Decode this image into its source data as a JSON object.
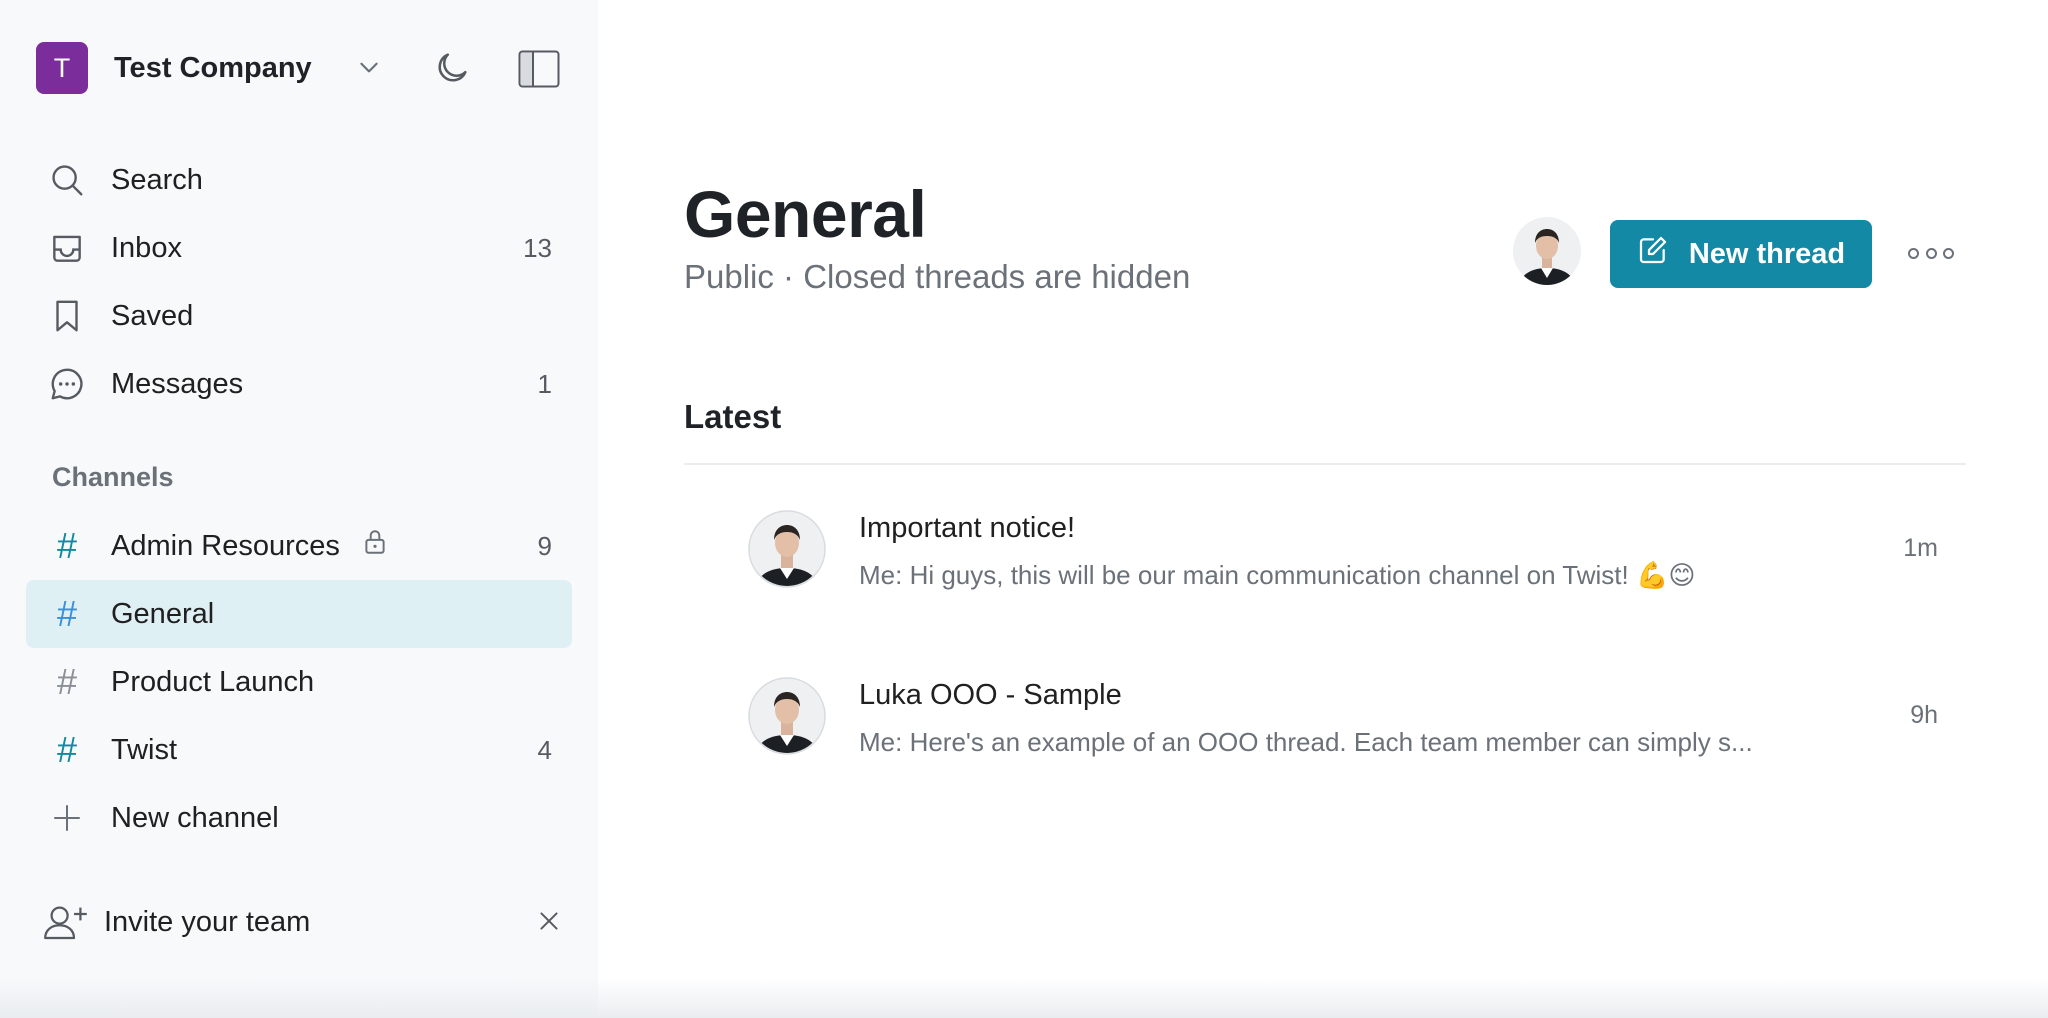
{
  "workspace": {
    "initial": "T",
    "name": "Test Company",
    "avatar_color": "#7b2d9b"
  },
  "nav": {
    "search": {
      "label": "Search",
      "icon": "search-icon"
    },
    "inbox": {
      "label": "Inbox",
      "count": "13",
      "icon": "inbox-icon"
    },
    "saved": {
      "label": "Saved",
      "icon": "bookmark-icon"
    },
    "messages": {
      "label": "Messages",
      "count": "1",
      "icon": "chat-bubble-icon"
    }
  },
  "channels": {
    "section_title": "Channels",
    "items": [
      {
        "name": "Admin Resources",
        "count": "9",
        "locked": true,
        "hash_color": "#12899f"
      },
      {
        "name": "General",
        "count": "",
        "active": true,
        "hash_color": "#3a8fd9"
      },
      {
        "name": "Product Launch",
        "count": "",
        "hash_color": "#8a9096"
      },
      {
        "name": "Twist",
        "count": "4",
        "hash_color": "#12899f"
      }
    ],
    "new_channel": "New channel"
  },
  "invite": {
    "label": "Invite your team"
  },
  "main": {
    "title": "General",
    "subtitle": "Public · Closed threads are hidden",
    "new_thread_label": "New thread",
    "latest_label": "Latest",
    "threads": [
      {
        "title": "Important notice!",
        "snippet": "Me: Hi guys, this will be our main communication channel on Twist! 💪😊",
        "time": "1m"
      },
      {
        "title": "Luka OOO - Sample",
        "snippet": "Me: Here's an example of an OOO thread. Each team member can simply s...",
        "time": "9h"
      }
    ]
  },
  "colors": {
    "accent": "#1389a6",
    "active_channel_bg": "#dff0f5",
    "sidebar_bg": "#f7f9fb"
  }
}
